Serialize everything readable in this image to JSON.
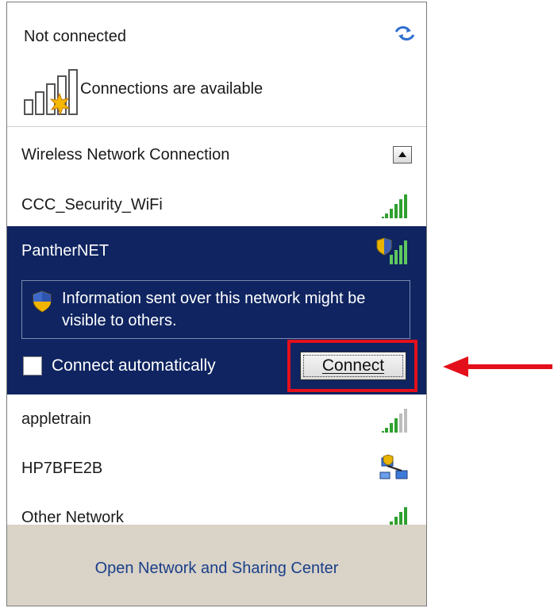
{
  "status": {
    "title": "Not connected",
    "subtitle": "Connections are available",
    "refresh_icon": "network-refresh-icon",
    "signal_icon": "signal-bars-star-icon"
  },
  "section": {
    "title": "Wireless Network Connection",
    "collapse_icon": "chevron-up-icon"
  },
  "networks": [
    {
      "name": "CCC_Security_WiFi",
      "secured": false,
      "icon": "signal-bars-icon"
    },
    {
      "name": "PantherNET",
      "secured": true,
      "icon": "shield-signal-bars-icon"
    },
    {
      "name": "appletrain",
      "secured": false,
      "icon": "signal-bars-weak-icon"
    },
    {
      "name": "HP7BFE2B",
      "secured": true,
      "icon": "adhoc-network-icon"
    },
    {
      "name": "Other Network",
      "secured": false,
      "icon": "signal-bars-icon"
    }
  ],
  "selected": {
    "warning": "Information sent over this network might be visible to others.",
    "auto_connect_label": "Connect automatically",
    "auto_connect_checked": false,
    "connect_label": "Connect",
    "connect_accesskey": "C"
  },
  "footer": {
    "link": "Open Network and Sharing Center"
  },
  "colors": {
    "selected_bg": "#0f2460",
    "footer_bg": "#d9d3c8",
    "highlight": "#e3101c",
    "signal_green": "#2fa02f"
  }
}
